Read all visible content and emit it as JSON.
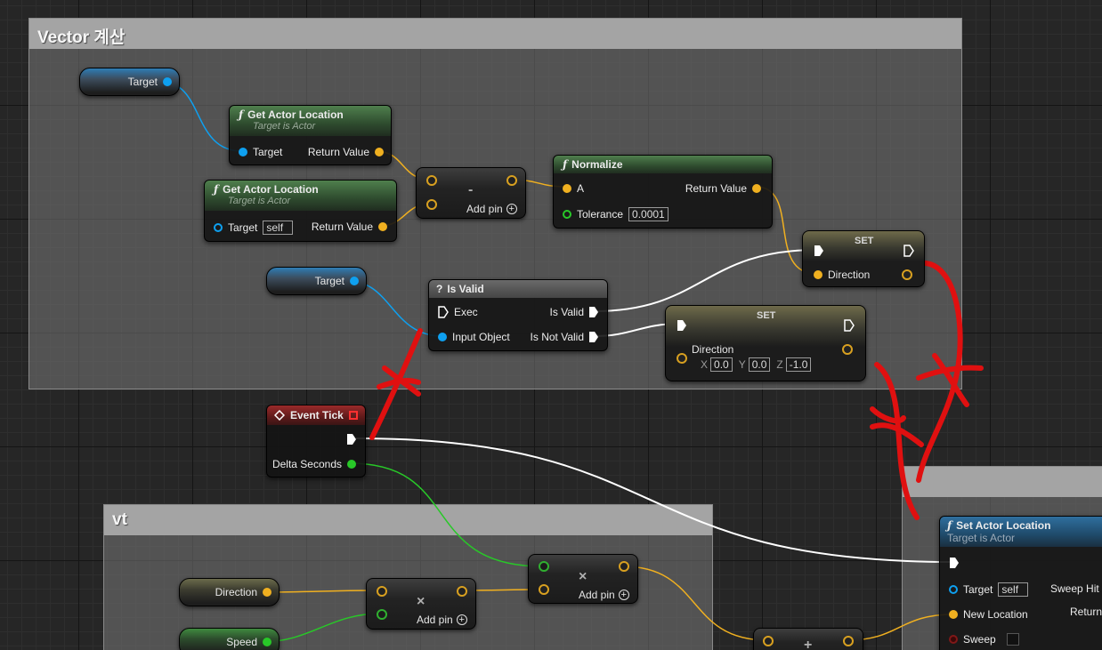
{
  "comments": {
    "vector_calc": "Vector 계산",
    "vt": "vt"
  },
  "nodes": {
    "target_var_1": "Target",
    "target_var_2": "Target",
    "direction_var": "Direction",
    "speed_var": "Speed",
    "get_actor_loc_1": {
      "title": "Get Actor Location",
      "subtitle": "Target is Actor",
      "in_label": "Target",
      "out_label": "Return Value"
    },
    "get_actor_loc_2": {
      "title": "Get Actor Location",
      "subtitle": "Target is Actor",
      "in_label": "Target",
      "in_value": "self",
      "out_label": "Return Value"
    },
    "subtract": {
      "symbol": "-",
      "add_pin": "Add pin"
    },
    "normalize": {
      "title": "Normalize",
      "in_label": "A",
      "out_label": "Return Value",
      "tolerance_label": "Tolerance",
      "tolerance_value": "0.0001"
    },
    "set_direction_1": {
      "title": "SET",
      "label": "Direction"
    },
    "is_valid": {
      "title": "Is Valid",
      "exec_label": "Exec",
      "input_label": "Input Object",
      "valid_label": "Is Valid",
      "not_valid_label": "Is Not Valid"
    },
    "set_direction_2": {
      "title": "SET",
      "label": "Direction",
      "x_label": "X",
      "x_value": "0.0",
      "y_label": "Y",
      "y_value": "0.0",
      "z_label": "Z",
      "z_value": "-1.0"
    },
    "event_tick": {
      "title": "Event Tick",
      "delta_label": "Delta Seconds"
    },
    "multiply_1": {
      "symbol": "×",
      "add_pin": "Add pin"
    },
    "multiply_2": {
      "symbol": "×",
      "add_pin": "Add pin"
    },
    "add_node": {
      "symbol": "+"
    },
    "set_actor_location": {
      "title": "Set Actor Location",
      "subtitle": "Target is Actor",
      "target_label": "Target",
      "target_value": "self",
      "new_location_label": "New Location",
      "sweep_label": "Sweep",
      "sweep_hit_label": "Sweep Hit R",
      "return_label": "Return"
    }
  },
  "colors": {
    "object_pin": "#0ea0f0",
    "vector_pin": "#f0b020",
    "float_pin": "#28c828",
    "exec_pin": "#ffffff",
    "annotation": "#e01010"
  }
}
